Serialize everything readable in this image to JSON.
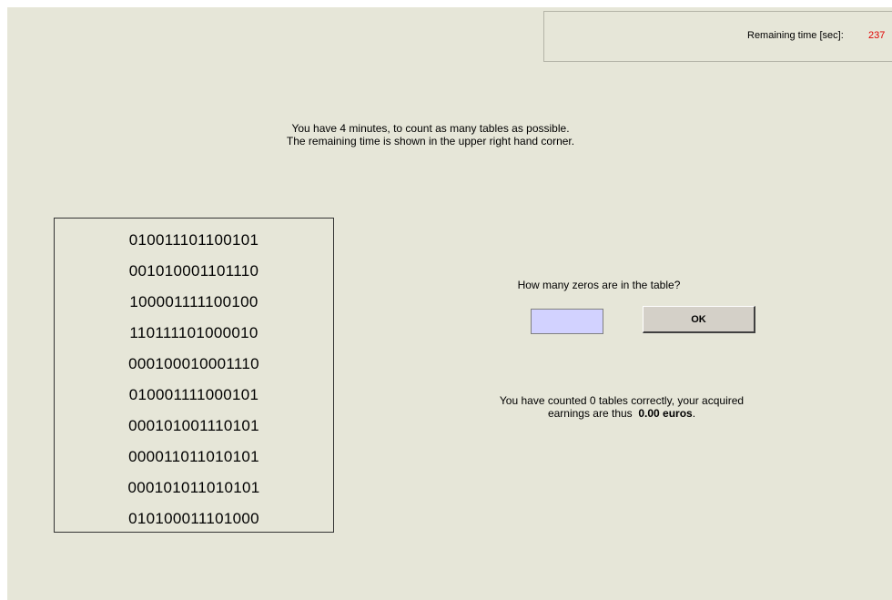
{
  "timer": {
    "label": "Remaining time [sec]:",
    "value": "237"
  },
  "instructions": {
    "line1": "You have 4 minutes, to count as many tables as possible.",
    "line2": "The remaining time is shown in the upper right hand corner."
  },
  "table": {
    "rows": [
      "010011101100101",
      "001010001101110",
      "100001111100100",
      "110111101000010",
      "000100010001110",
      "010001111000101",
      "000101001110101",
      "000011011010101",
      "000101011010101",
      "010100011101000"
    ]
  },
  "question": {
    "text": "How many zeros are in the table?",
    "answer_value": "",
    "ok_label": "OK"
  },
  "earnings": {
    "line1": "You have counted 0 tables correctly, your acquired",
    "line2_prefix": "earnings are thus",
    "amount": "0.00 euros",
    "line2_suffix": "."
  },
  "colors": {
    "background": "#e6e6d8",
    "timer_value": "#e00000",
    "input_background": "#d2d2ff"
  }
}
